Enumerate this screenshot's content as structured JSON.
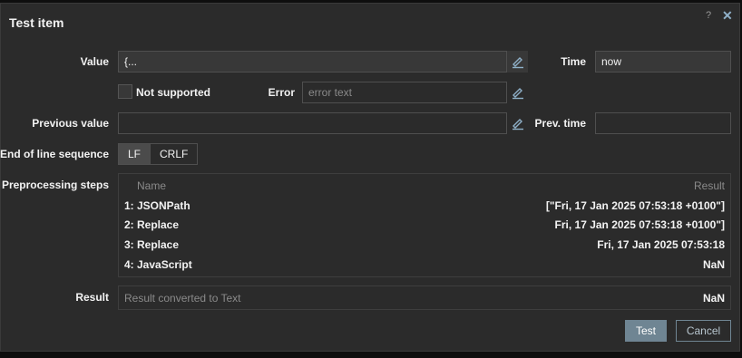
{
  "dialog": {
    "title": "Test item",
    "help_label": "?",
    "close_label": "✕"
  },
  "value": {
    "label": "Value",
    "text": "{..."
  },
  "time": {
    "label": "Time",
    "text": "now"
  },
  "not_supported": {
    "label": "Not supported",
    "checked": false
  },
  "error": {
    "label": "Error",
    "placeholder": "error text"
  },
  "previous_value": {
    "label": "Previous value",
    "text": ""
  },
  "prev_time": {
    "label": "Prev. time",
    "text": ""
  },
  "eol": {
    "label": "End of line sequence",
    "options": [
      "LF",
      "CRLF"
    ],
    "selected": "LF"
  },
  "preprocessing": {
    "label": "Preprocessing steps",
    "col_name": "Name",
    "col_result": "Result",
    "steps": [
      {
        "name": "1:  JSONPath",
        "result": "[\"Fri, 17 Jan 2025 07:53:18 +0100\"]"
      },
      {
        "name": "2:  Replace",
        "result": "Fri, 17 Jan 2025 07:53:18 +0100\"]"
      },
      {
        "name": "3:  Replace",
        "result": "Fri, 17 Jan 2025 07:53:18"
      },
      {
        "name": "4:  JavaScript",
        "result": "NaN"
      }
    ]
  },
  "result": {
    "label": "Result",
    "placeholder": "Result converted to Text",
    "value": "NaN"
  },
  "buttons": {
    "test": "Test",
    "cancel": "Cancel"
  },
  "colors": {
    "primary_button": "#6f8593",
    "accent_icon": "#8fb0c8"
  },
  "icons": {
    "edit": "pencil-icon",
    "help": "help-icon",
    "close": "close-icon"
  }
}
